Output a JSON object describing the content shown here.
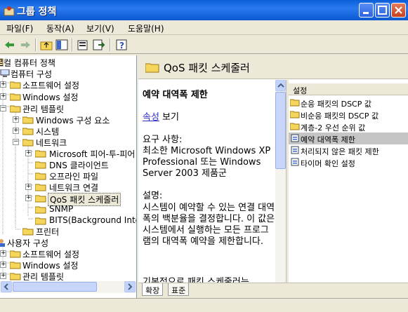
{
  "window": {
    "title": "그룹 정책"
  },
  "menu": [
    "파일(F)",
    "동작(A)",
    "보기(V)",
    "도움말(H)"
  ],
  "tree": {
    "root": "로컬 컴퓨터 정책",
    "computer_config": "컴퓨터 구성",
    "software_settings": "소프트웨어 설정",
    "windows_settings": "Windows 설정",
    "admin_templates": "관리 템플릿",
    "windows_components": "Windows 구성 요소",
    "system": "시스템",
    "network": "네트워크",
    "microsoft_peer": "Microsoft 피어-투-피어",
    "dns_client": "DNS 클라이언트",
    "offline_files": "오프라인 파일",
    "network_connections": "네트워크 연결",
    "qos": "QoS 패킷 스케줄러",
    "snmp": "SNMP",
    "bits": "BITS(Background Intelligent",
    "printers": "프린터",
    "user_config": "사용자 구성",
    "user_software": "소프트웨어 설정",
    "user_windows": "Windows 설정",
    "user_admin": "관리 템플릿"
  },
  "right": {
    "header_title": "QoS 패킷 스케줄러",
    "desc_title": "예약 대역폭 제한",
    "properties_link": "속성",
    "properties_suffix": " 보기",
    "requirements_label": "요구 사항:",
    "requirements_text": "최소한 Microsoft Windows XP Professional 또는 Windows Server 2003 제품군",
    "description_label": "설명:",
    "description_text": "시스템이 예약할 수 있는 연결 대역폭의 백분율을 결정합니다. 이 값은 시스템에서 실행하는 모든 프로그램의 대역폭 예약을 제한합니다.",
    "cut_text": "기본적으로 패킷 스케줄러는",
    "settings_header": "설정",
    "settings": [
      "순응 패킷의 DSCP 값",
      "비순응 패킷의 DSCP 값",
      "계층-2 우선 순위 값",
      "예약 대역폭 제한",
      "처리되지 않은 패킷 제한",
      "타이머 확인 설정"
    ],
    "selected_setting_index": 3
  },
  "tabs": [
    "확장",
    "표준"
  ],
  "colors": {
    "title_bar": "#0a5fd8",
    "selection": "#c5c5c5",
    "link": "#2c2cc8"
  }
}
